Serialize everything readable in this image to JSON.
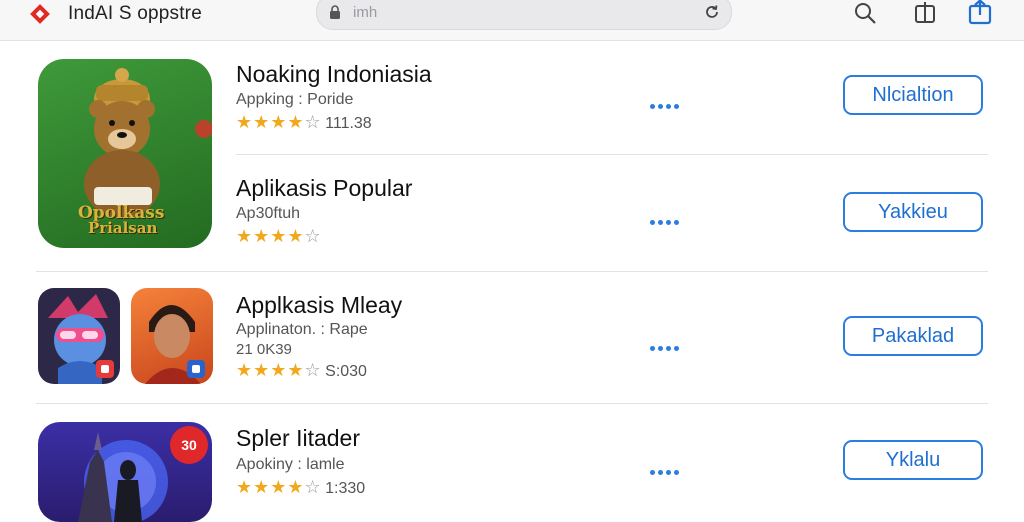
{
  "header": {
    "title": "IndAI S oppstre",
    "url_text": "imh",
    "brand_color": "#e02a24"
  },
  "apps": [
    {
      "name": "Noaking Indoniasia",
      "subtitle": "Appking : Poride",
      "rating_text": "111.38",
      "stars": 4,
      "button": "Nlcialtion",
      "icon_text_1": "Opolkass",
      "icon_text_2": "Prialsan"
    },
    {
      "name": "Aplikasis Popular",
      "subtitle": "Ap30ftuh",
      "rating_text": "",
      "stars": 4,
      "button": "Yakkieu"
    },
    {
      "name": "Applkasis Mleay",
      "subtitle": "Applinaton. : Rape",
      "subtitle2": "21 0K39",
      "rating_text": "S:030",
      "stars": 4,
      "button": "Pakaklad"
    },
    {
      "name": "Spler Iitader",
      "subtitle": "Apokiny : lamle",
      "rating_text": "1:330",
      "stars": 4,
      "button": "Yklalu",
      "icon_badge": "30"
    }
  ],
  "icons": {
    "logo": "diamond-logo-icon",
    "lock": "lock-icon",
    "reload": "reload-icon",
    "search": "search-icon",
    "tabs": "tabs-icon",
    "share": "share-icon",
    "more": "more-dots-icon"
  },
  "colors": {
    "accent": "#2a7de1",
    "star": "#f2a81d",
    "star_empty": "#9a9aa0"
  }
}
